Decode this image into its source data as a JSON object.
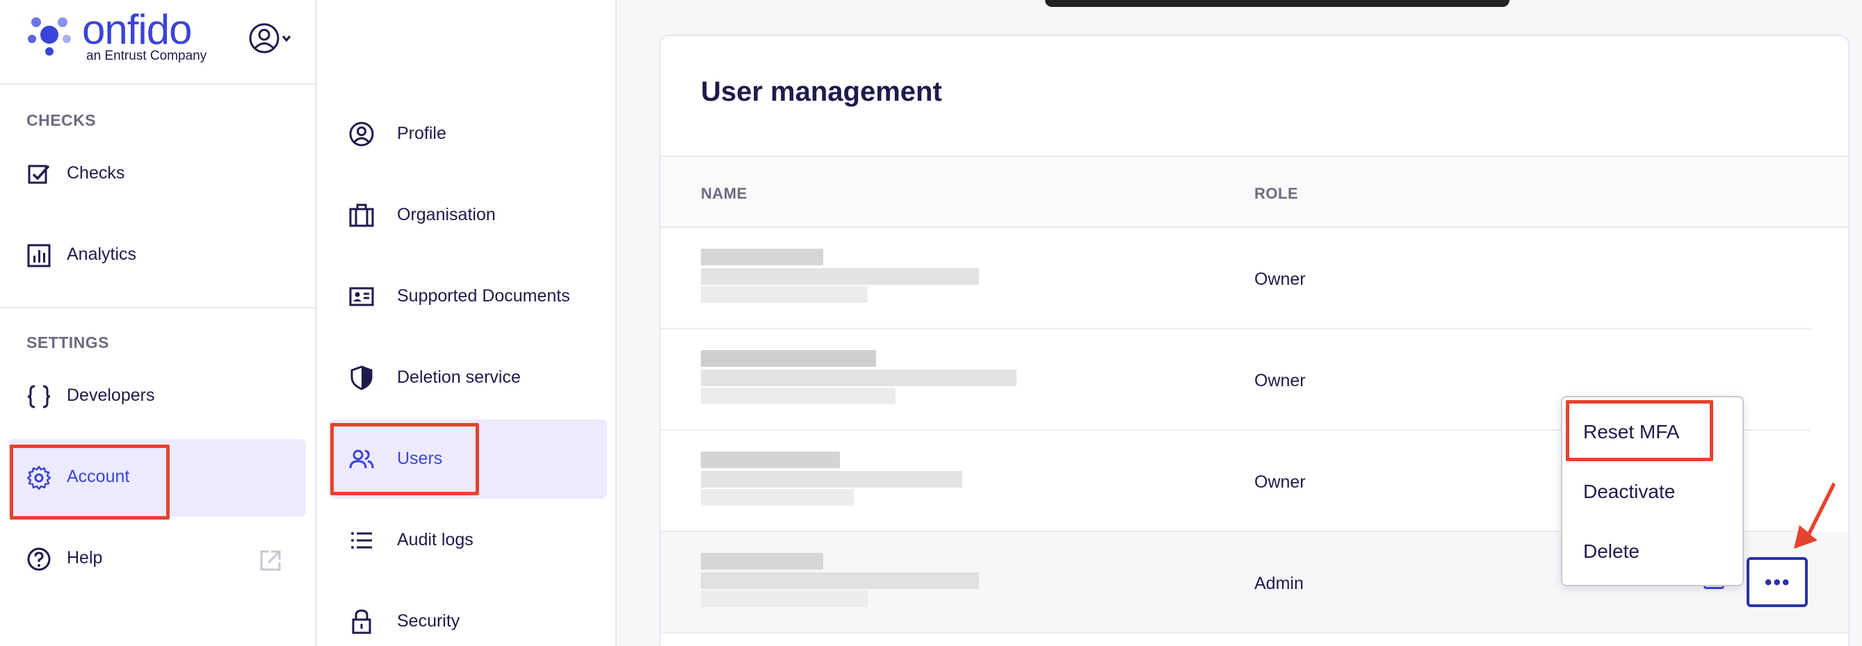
{
  "brand": {
    "name": "onfido",
    "tagline": "an Entrust Company",
    "color": "#3b44d6"
  },
  "sidebar": {
    "checks_title": "CHECKS",
    "checks_items": [
      {
        "label": "Checks",
        "icon": "checkbox-icon"
      },
      {
        "label": "Analytics",
        "icon": "bar-chart-icon"
      }
    ],
    "settings_title": "SETTINGS",
    "settings_items": [
      {
        "label": "Developers",
        "icon": "braces-icon"
      },
      {
        "label": "Account",
        "icon": "gear-icon",
        "active": true
      },
      {
        "label": "Help",
        "icon": "help-icon"
      }
    ]
  },
  "account_nav": {
    "items": [
      {
        "label": "Profile",
        "icon": "user-circle-icon"
      },
      {
        "label": "Organisation",
        "icon": "briefcase-icon"
      },
      {
        "label": "Supported Documents",
        "icon": "id-card-icon"
      },
      {
        "label": "Deletion service",
        "icon": "shield-icon"
      },
      {
        "label": "Users",
        "icon": "users-icon",
        "active": true
      },
      {
        "label": "Audit logs",
        "icon": "list-icon"
      },
      {
        "label": "Security",
        "icon": "lock-icon"
      }
    ]
  },
  "main": {
    "title": "User management",
    "columns": {
      "name": "NAME",
      "role": "ROLE"
    },
    "rows": [
      {
        "role": "Owner"
      },
      {
        "role": "Owner"
      },
      {
        "role": "Owner"
      },
      {
        "role": "Admin"
      }
    ]
  },
  "row_menu": {
    "items": [
      "Reset MFA",
      "Deactivate",
      "Delete"
    ],
    "more_label": "•••"
  },
  "colors": {
    "highlight": "#e5432d",
    "accent": "#3b44d6",
    "active_bg": "#eceaff"
  }
}
